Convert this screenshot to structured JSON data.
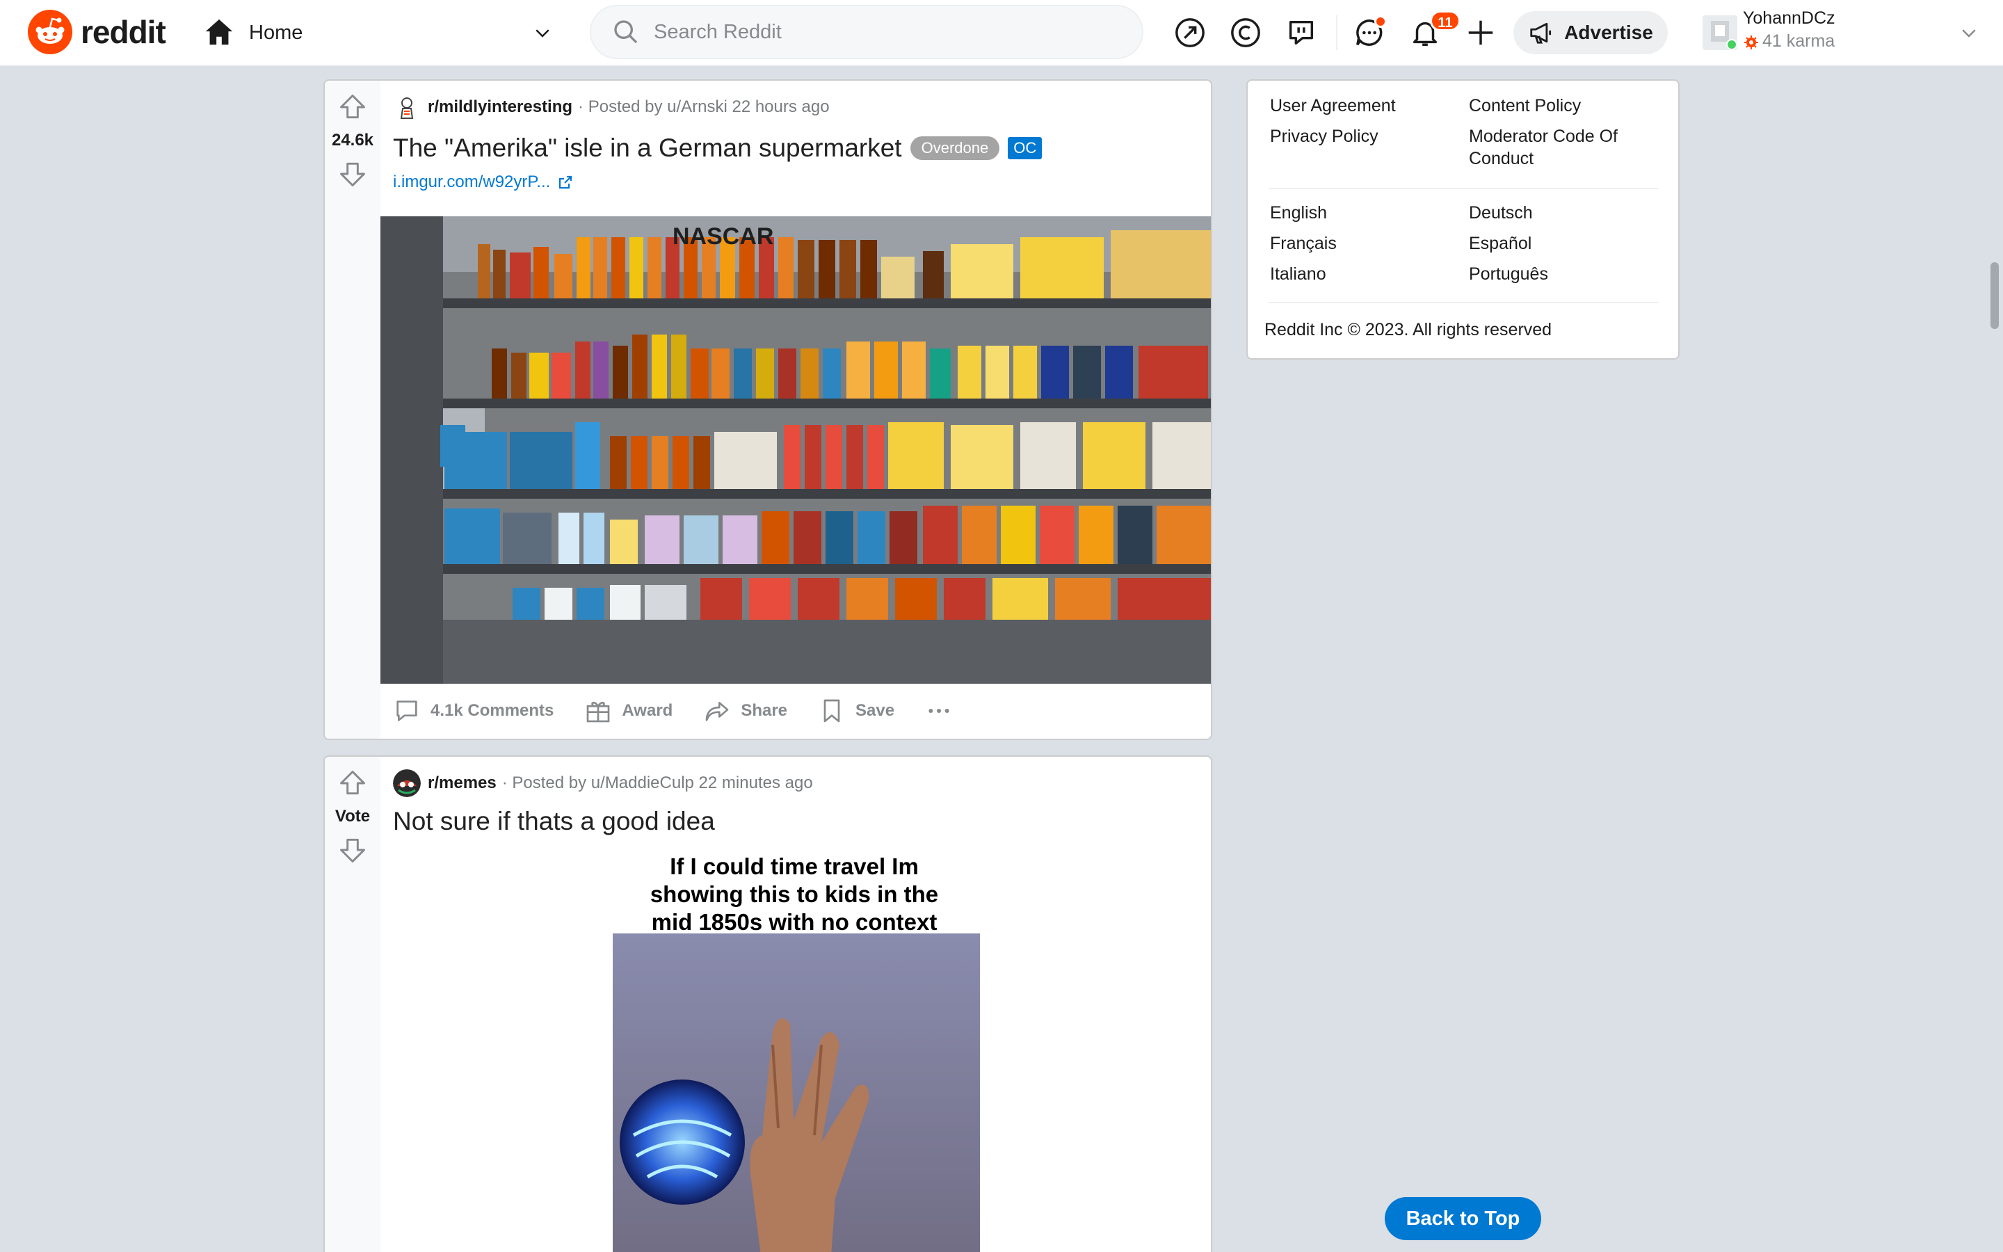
{
  "header": {
    "logo_text": "reddit",
    "home_label": "Home",
    "search_placeholder": "Search Reddit",
    "notifications_count": "11",
    "advertise_label": "Advertise",
    "username": "YohannDCz",
    "karma": "41 karma"
  },
  "posts": [
    {
      "subreddit": "r/mildlyinteresting",
      "posted_by": "· Posted by u/Arnski 22 hours ago",
      "votes": "24.6k",
      "title": "The \"Amerika\" isle in a German supermarket",
      "flair": "Overdone",
      "oc_tag": "OC",
      "link": "i.imgur.com/w92yrP...",
      "comments": "4.1k Comments",
      "award": "Award",
      "share": "Share",
      "save": "Save"
    },
    {
      "subreddit": "r/memes",
      "posted_by": "· Posted by u/MaddieCulp 22 minutes ago",
      "votes": "Vote",
      "title": "Not sure if thats a good idea",
      "meme_caption": [
        "If I could time travel Im",
        "showing this to kids in the",
        "mid 1850s with no context"
      ]
    }
  ],
  "sidebar": {
    "links_col1": [
      "User Agreement",
      "Privacy Policy"
    ],
    "links_col2": [
      "Content Policy",
      "Moderator Code Of",
      "Conduct"
    ],
    "languages_col1": [
      "English",
      "Français",
      "Italiano"
    ],
    "languages_col2": [
      "Deutsch",
      "Español",
      "Português"
    ],
    "copyright": "Reddit Inc © 2023. All rights reserved"
  },
  "back_to_top": "Back to Top",
  "colors": {
    "brand": "#ff4500",
    "link": "#0079d3",
    "flair": "#a5a4a4"
  }
}
